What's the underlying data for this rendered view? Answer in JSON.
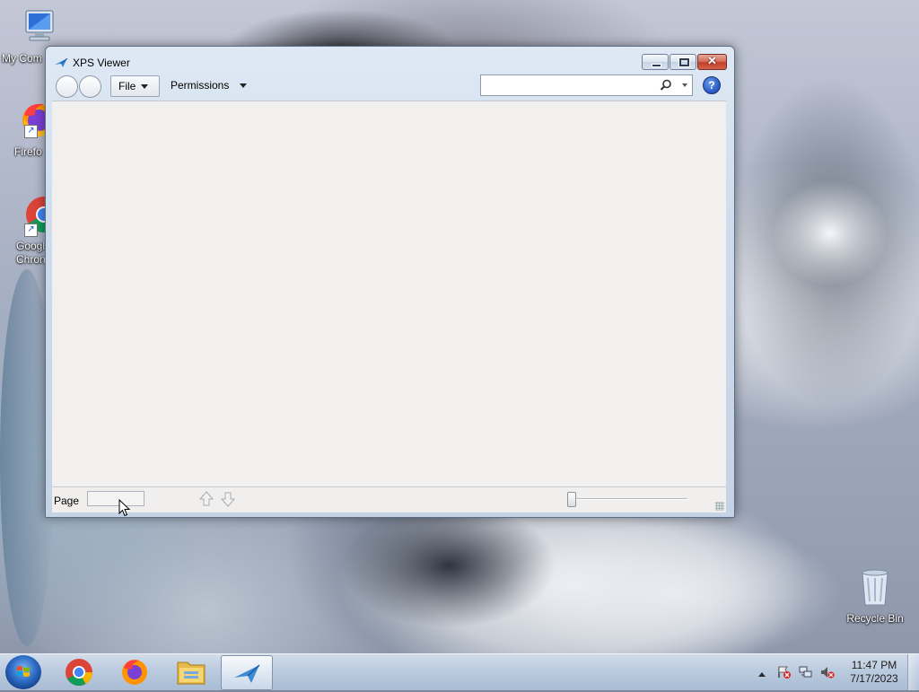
{
  "desktop": {
    "icons": [
      {
        "label": "My Computer",
        "icon": "computer-icon"
      },
      {
        "label": "Firefox",
        "icon": "firefox-icon"
      },
      {
        "label": "Google Chrome",
        "icon": "chrome-icon"
      },
      {
        "label": "Recycle Bin",
        "icon": "recycle-bin-icon"
      }
    ],
    "visible_labels": {
      "my_computer": "My Com",
      "firefox": "Firefo",
      "chrome_line1": "Googl",
      "chrome_line2": "Chron",
      "recycle_bin": "Recycle Bin"
    }
  },
  "window": {
    "title": "XPS Viewer",
    "icon": "xps-viewer-icon",
    "toolbar": {
      "file_label": "File",
      "permissions_label": "Permissions",
      "search_value": "",
      "search_placeholder": "",
      "help_glyph": "?"
    },
    "statusbar": {
      "page_label": "Page",
      "page_value": ""
    }
  },
  "taskbar": {
    "apps": [
      "chrome-icon",
      "firefox-icon",
      "file-explorer-icon",
      "xps-viewer-icon"
    ],
    "active_app": "xps-viewer-icon",
    "clock_time": "11:47 PM",
    "clock_date": "7/17/2023"
  },
  "colors": {
    "taskbar": "#bccde2",
    "doc_background": "#f1f0ef",
    "close_button": "#c2402a",
    "help_blue": "#2c5fc9"
  }
}
